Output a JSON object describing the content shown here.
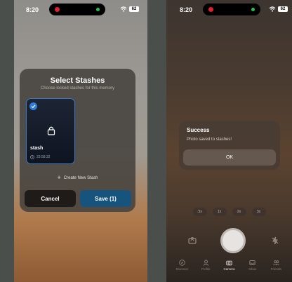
{
  "left_screen": {
    "status": {
      "time": "8:20",
      "battery": "62"
    },
    "modal": {
      "title": "Select Stashes",
      "subtitle": "Choose locked stashes for this memory",
      "stash": {
        "name": "stash",
        "time": "23:58:32",
        "selected": true
      },
      "create_label": "Create New Stash",
      "cancel_label": "Cancel",
      "save_label": "Save (1)"
    }
  },
  "right_screen": {
    "status": {
      "time": "8:20",
      "battery": "62"
    },
    "alert": {
      "title": "Success",
      "message": "Photo saved to stashes!",
      "ok_label": "OK"
    },
    "zoom_options": [
      ".5x",
      "1x",
      "2x",
      "3x"
    ],
    "tabs": [
      {
        "label": "Discover",
        "icon": "compass-icon"
      },
      {
        "label": "Profile",
        "icon": "person-icon"
      },
      {
        "label": "Camera",
        "icon": "camera-icon",
        "active": true
      },
      {
        "label": "Inbox",
        "icon": "inbox-icon"
      },
      {
        "label": "Friends",
        "icon": "friends-icon"
      }
    ]
  },
  "colors": {
    "accent": "#2f7bd6",
    "save_button": "#16547e",
    "cancel_button": "#1e1b19"
  }
}
